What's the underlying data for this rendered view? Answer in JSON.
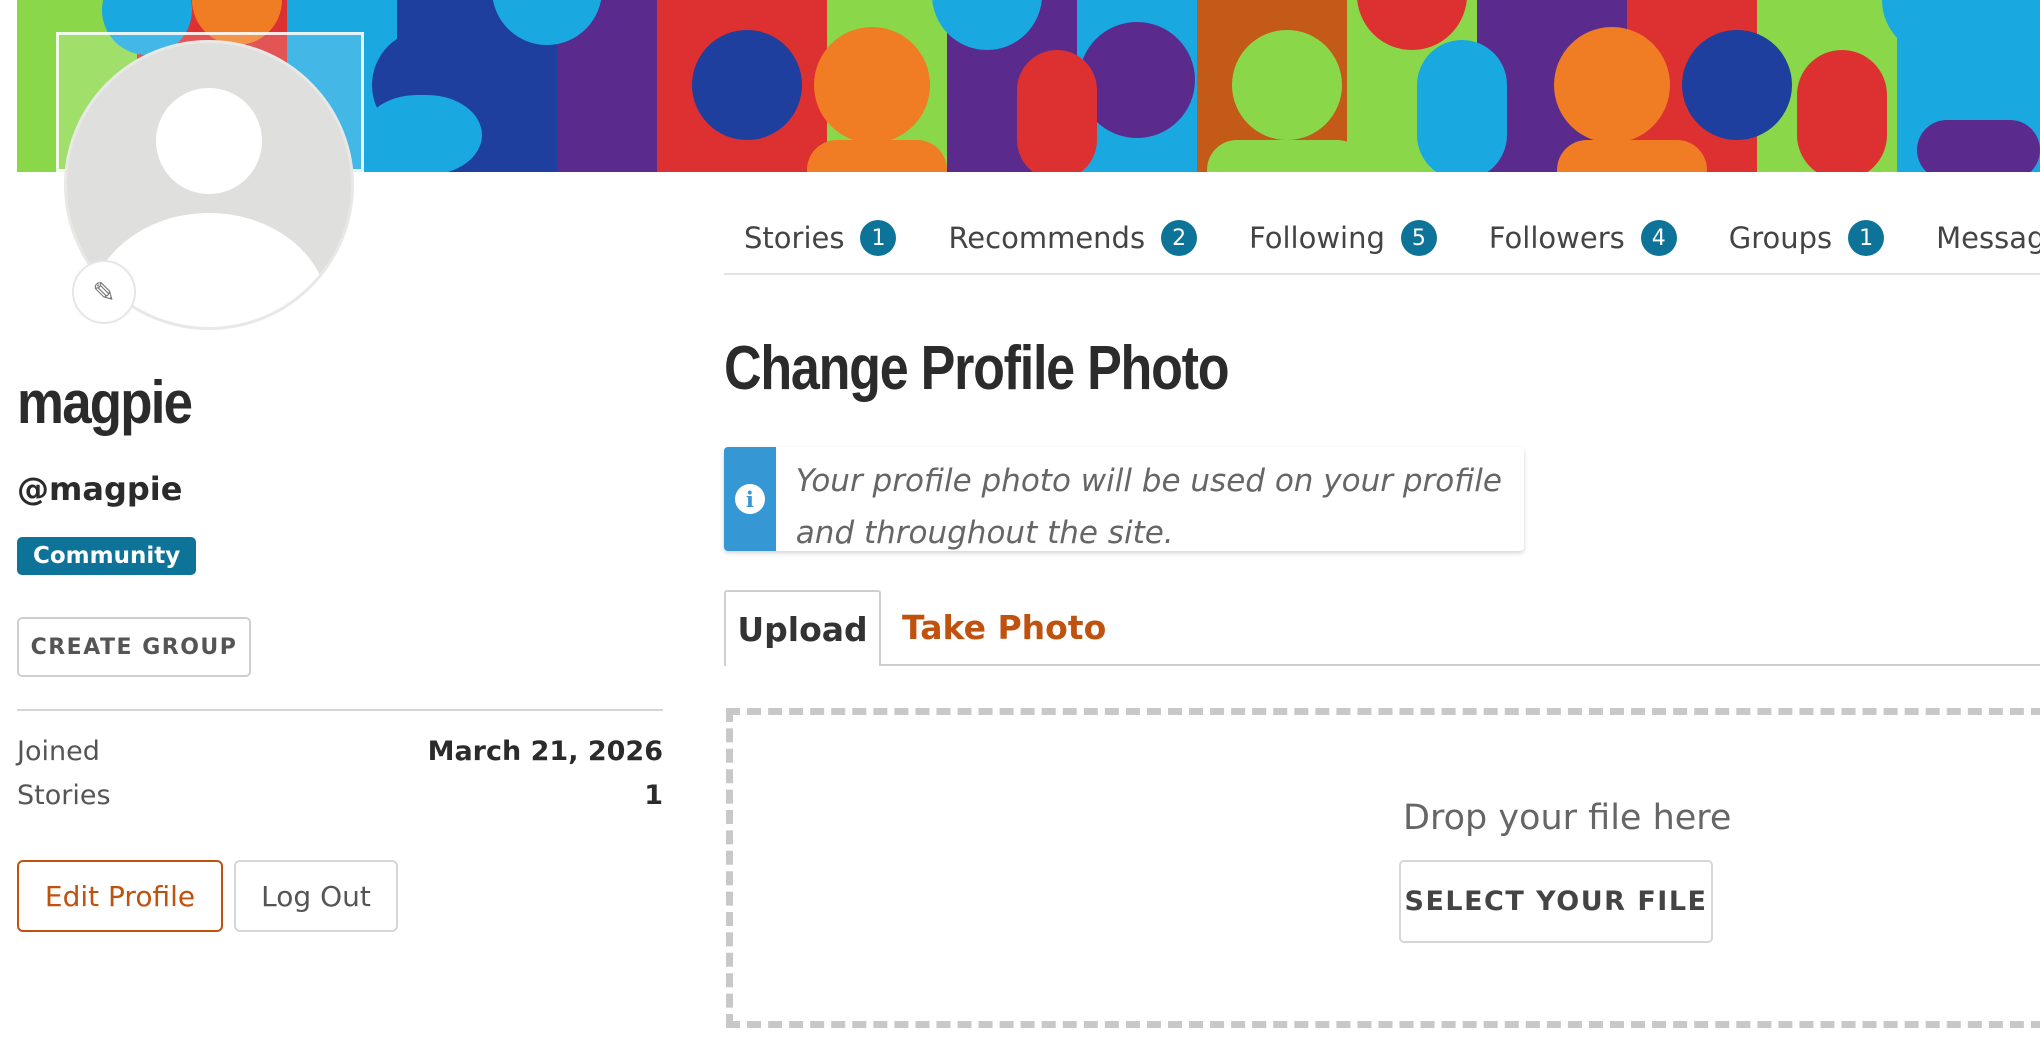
{
  "profile": {
    "username": "magpie",
    "handle": "@magpie",
    "role_badge": "Community",
    "create_group_label": "CREATE GROUP",
    "stats": [
      {
        "label": "Joined",
        "value": "March 21, 2026"
      },
      {
        "label": "Stories",
        "value": "1"
      }
    ],
    "edit_profile_label": "Edit Profile",
    "logout_label": "Log Out"
  },
  "nav": {
    "tabs": [
      {
        "label": "Stories",
        "count": "1"
      },
      {
        "label": "Recommends",
        "count": "2"
      },
      {
        "label": "Following",
        "count": "5"
      },
      {
        "label": "Followers",
        "count": "4"
      },
      {
        "label": "Groups",
        "count": "1"
      },
      {
        "label": "Messages",
        "count": null
      }
    ]
  },
  "main": {
    "title": "Change Profile Photo",
    "info_text": "Your profile photo will be used on your profile and throughout the site.",
    "photo_tabs": {
      "upload": "Upload",
      "take_photo": "Take Photo"
    },
    "drop_label": "Drop your file here",
    "select_file_label": "SELECT YOUR FILE"
  },
  "colors": {
    "accent_teal": "#0d7399",
    "accent_orange": "#c0520f",
    "info_blue": "#3597d4"
  },
  "icons": {
    "edit_photo": "pencil-icon",
    "info": "info-icon"
  }
}
